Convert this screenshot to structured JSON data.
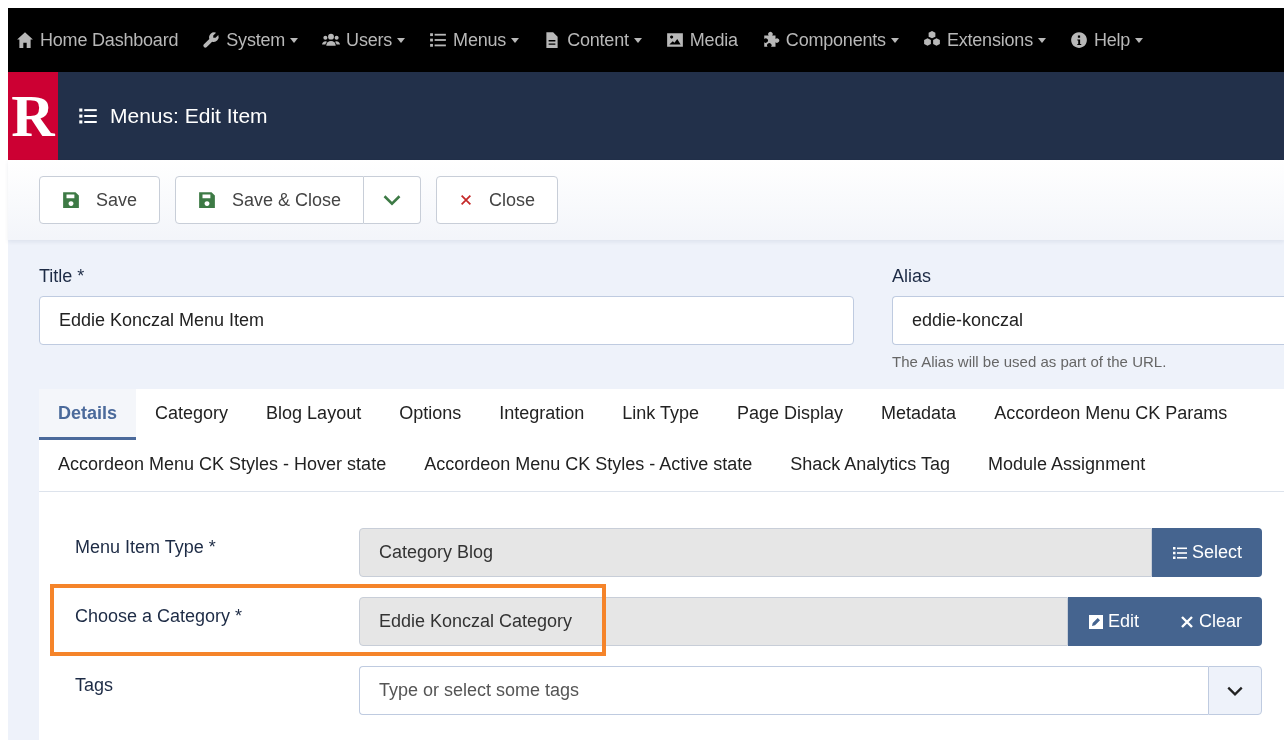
{
  "nav": [
    {
      "kind": "home",
      "label": "Home Dashboard",
      "dropdown": false
    },
    {
      "kind": "wrench",
      "label": "System",
      "dropdown": true
    },
    {
      "kind": "users",
      "label": "Users",
      "dropdown": true
    },
    {
      "kind": "list",
      "label": "Menus",
      "dropdown": true
    },
    {
      "kind": "file",
      "label": "Content",
      "dropdown": true
    },
    {
      "kind": "image",
      "label": "Media",
      "dropdown": false
    },
    {
      "kind": "puzzle",
      "label": "Components",
      "dropdown": true
    },
    {
      "kind": "cubes",
      "label": "Extensions",
      "dropdown": true
    },
    {
      "kind": "info",
      "label": "Help",
      "dropdown": true
    }
  ],
  "header": {
    "logo": "R",
    "title": "Menus: Edit Item"
  },
  "toolbar": [
    {
      "kind": "save",
      "label": "Save",
      "split": false
    },
    {
      "kind": "save",
      "label": "Save & Close",
      "split": true
    },
    {
      "kind": "close",
      "label": "Close",
      "split": false
    }
  ],
  "title_field": {
    "label": "Title *",
    "value": "Eddie Konczal Menu Item"
  },
  "alias_field": {
    "label": "Alias",
    "value": "eddie-konczal",
    "help": "The Alias will be used as part of the URL."
  },
  "tabs": [
    {
      "label": "Details",
      "selected": true
    },
    {
      "label": "Category",
      "selected": false
    },
    {
      "label": "Blog Layout",
      "selected": false
    },
    {
      "label": "Options",
      "selected": false
    },
    {
      "label": "Integration",
      "selected": false
    },
    {
      "label": "Link Type",
      "selected": false
    },
    {
      "label": "Page Display",
      "selected": false
    },
    {
      "label": "Metadata",
      "selected": false
    },
    {
      "label": "Accordeon Menu CK Params",
      "selected": false
    },
    {
      "label": "Accordeon Menu CK Styles - Hover state",
      "selected": false
    },
    {
      "label": "Accordeon Menu CK Styles - Active state",
      "selected": false
    },
    {
      "label": "Shack Analytics Tag",
      "selected": false
    },
    {
      "label": "Module Assignment",
      "selected": false
    }
  ],
  "fields": [
    {
      "kind": "picker",
      "label": "Menu Item Type *",
      "value": "Category Blog",
      "highlighted": false,
      "buttons": [
        {
          "kind": "list",
          "label": "Select"
        }
      ]
    },
    {
      "kind": "picker",
      "label": "Choose a Category *",
      "value": "Eddie Konczal Category",
      "highlighted": true,
      "buttons": [
        {
          "kind": "edit",
          "label": "Edit"
        },
        {
          "kind": "x",
          "label": "Clear"
        }
      ]
    },
    {
      "kind": "tags",
      "label": "Tags",
      "placeholder": "Type or select some tags",
      "highlighted": false
    }
  ]
}
